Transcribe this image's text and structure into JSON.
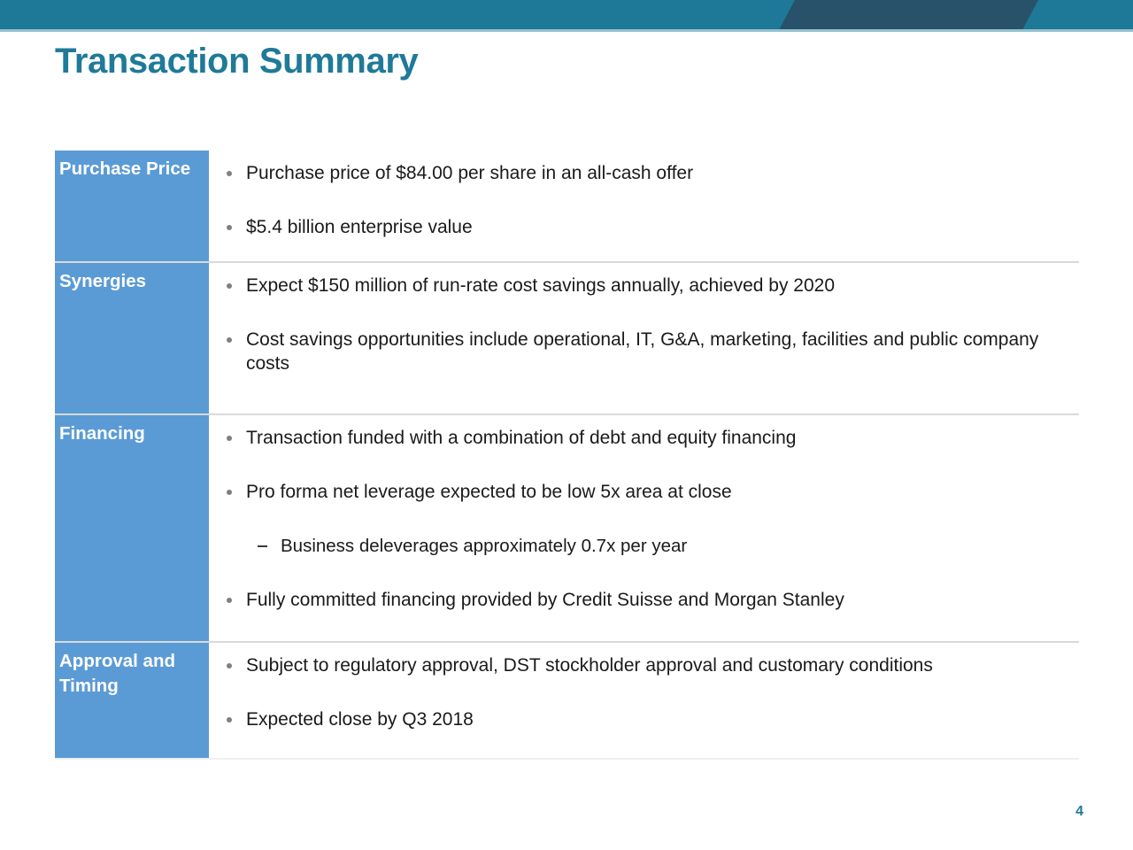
{
  "header": {
    "band_color": "#1E7898",
    "accent_shape_color": "#27526A"
  },
  "title": "Transaction Summary",
  "title_color": "#1F7A99",
  "label_cell_color": "#5B9BD5",
  "table": {
    "rows": [
      {
        "label": "Purchase Price",
        "bullets": [
          "Purchase price of $84.00 per share in an all-cash offer",
          "$5.4 billion enterprise value"
        ]
      },
      {
        "label": "Synergies",
        "bullets": [
          "Expect $150 million of run-rate cost savings annually, achieved by 2020",
          "Cost savings opportunities include operational, IT, G&A, marketing, facilities and public company costs"
        ]
      },
      {
        "label": "Financing",
        "bullets": [
          "Transaction funded with a combination of debt and equity financing",
          "Pro forma net leverage expected to be low 5x area at close"
        ],
        "sub_bullet": "Business deleverages approximately 0.7x per year",
        "bullet_after_sub": "Fully committed financing provided by Credit Suisse and Morgan Stanley"
      },
      {
        "label": "Approval and Timing",
        "bullets": [
          "Subject to regulatory approval, DST stockholder approval and customary conditions",
          "Expected close by Q3 2018"
        ]
      }
    ]
  },
  "footer": {
    "page_number": "4"
  }
}
